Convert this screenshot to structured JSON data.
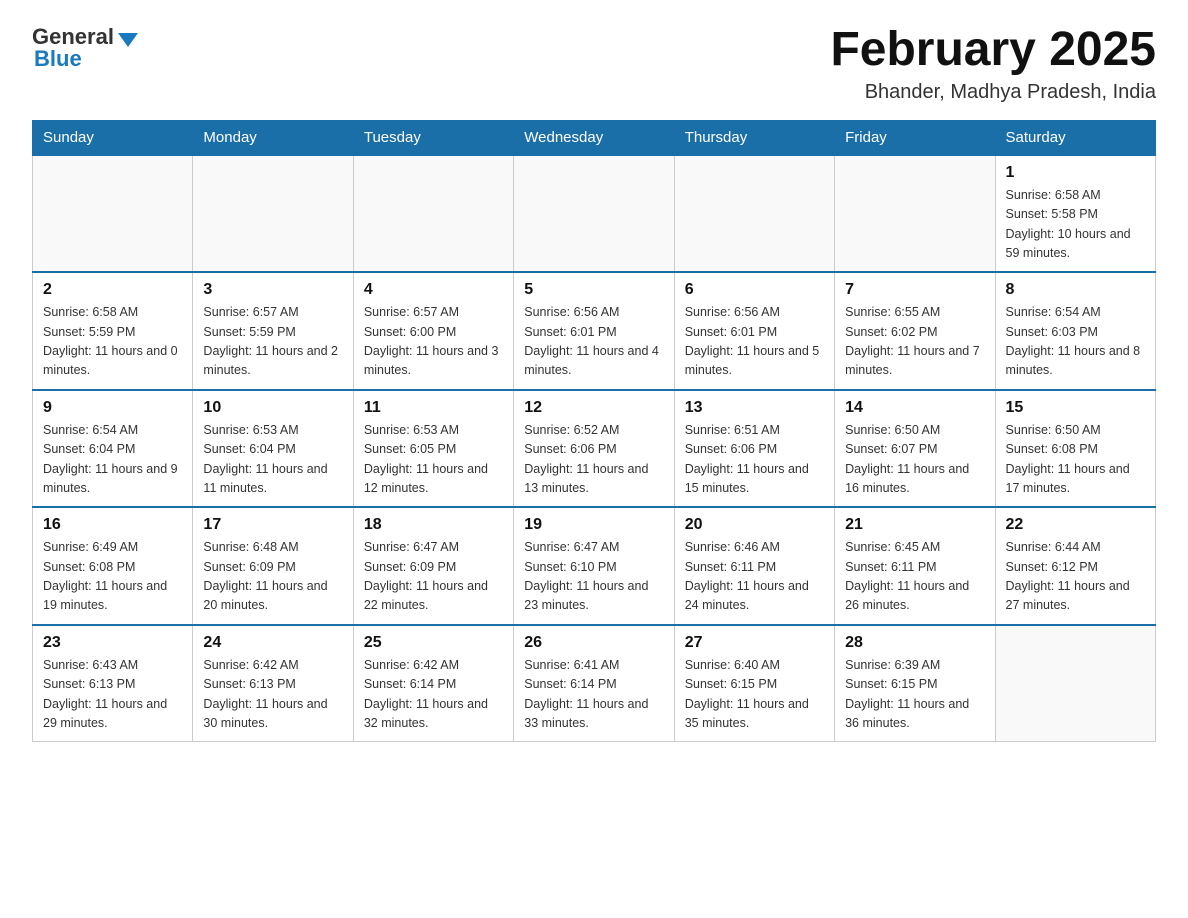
{
  "header": {
    "logo_general": "General",
    "logo_blue": "Blue",
    "month_title": "February 2025",
    "location": "Bhander, Madhya Pradesh, India"
  },
  "weekdays": [
    "Sunday",
    "Monday",
    "Tuesday",
    "Wednesday",
    "Thursday",
    "Friday",
    "Saturday"
  ],
  "weeks": [
    [
      {
        "day": "",
        "info": ""
      },
      {
        "day": "",
        "info": ""
      },
      {
        "day": "",
        "info": ""
      },
      {
        "day": "",
        "info": ""
      },
      {
        "day": "",
        "info": ""
      },
      {
        "day": "",
        "info": ""
      },
      {
        "day": "1",
        "info": "Sunrise: 6:58 AM\nSunset: 5:58 PM\nDaylight: 10 hours and 59 minutes."
      }
    ],
    [
      {
        "day": "2",
        "info": "Sunrise: 6:58 AM\nSunset: 5:59 PM\nDaylight: 11 hours and 0 minutes."
      },
      {
        "day": "3",
        "info": "Sunrise: 6:57 AM\nSunset: 5:59 PM\nDaylight: 11 hours and 2 minutes."
      },
      {
        "day": "4",
        "info": "Sunrise: 6:57 AM\nSunset: 6:00 PM\nDaylight: 11 hours and 3 minutes."
      },
      {
        "day": "5",
        "info": "Sunrise: 6:56 AM\nSunset: 6:01 PM\nDaylight: 11 hours and 4 minutes."
      },
      {
        "day": "6",
        "info": "Sunrise: 6:56 AM\nSunset: 6:01 PM\nDaylight: 11 hours and 5 minutes."
      },
      {
        "day": "7",
        "info": "Sunrise: 6:55 AM\nSunset: 6:02 PM\nDaylight: 11 hours and 7 minutes."
      },
      {
        "day": "8",
        "info": "Sunrise: 6:54 AM\nSunset: 6:03 PM\nDaylight: 11 hours and 8 minutes."
      }
    ],
    [
      {
        "day": "9",
        "info": "Sunrise: 6:54 AM\nSunset: 6:04 PM\nDaylight: 11 hours and 9 minutes."
      },
      {
        "day": "10",
        "info": "Sunrise: 6:53 AM\nSunset: 6:04 PM\nDaylight: 11 hours and 11 minutes."
      },
      {
        "day": "11",
        "info": "Sunrise: 6:53 AM\nSunset: 6:05 PM\nDaylight: 11 hours and 12 minutes."
      },
      {
        "day": "12",
        "info": "Sunrise: 6:52 AM\nSunset: 6:06 PM\nDaylight: 11 hours and 13 minutes."
      },
      {
        "day": "13",
        "info": "Sunrise: 6:51 AM\nSunset: 6:06 PM\nDaylight: 11 hours and 15 minutes."
      },
      {
        "day": "14",
        "info": "Sunrise: 6:50 AM\nSunset: 6:07 PM\nDaylight: 11 hours and 16 minutes."
      },
      {
        "day": "15",
        "info": "Sunrise: 6:50 AM\nSunset: 6:08 PM\nDaylight: 11 hours and 17 minutes."
      }
    ],
    [
      {
        "day": "16",
        "info": "Sunrise: 6:49 AM\nSunset: 6:08 PM\nDaylight: 11 hours and 19 minutes."
      },
      {
        "day": "17",
        "info": "Sunrise: 6:48 AM\nSunset: 6:09 PM\nDaylight: 11 hours and 20 minutes."
      },
      {
        "day": "18",
        "info": "Sunrise: 6:47 AM\nSunset: 6:09 PM\nDaylight: 11 hours and 22 minutes."
      },
      {
        "day": "19",
        "info": "Sunrise: 6:47 AM\nSunset: 6:10 PM\nDaylight: 11 hours and 23 minutes."
      },
      {
        "day": "20",
        "info": "Sunrise: 6:46 AM\nSunset: 6:11 PM\nDaylight: 11 hours and 24 minutes."
      },
      {
        "day": "21",
        "info": "Sunrise: 6:45 AM\nSunset: 6:11 PM\nDaylight: 11 hours and 26 minutes."
      },
      {
        "day": "22",
        "info": "Sunrise: 6:44 AM\nSunset: 6:12 PM\nDaylight: 11 hours and 27 minutes."
      }
    ],
    [
      {
        "day": "23",
        "info": "Sunrise: 6:43 AM\nSunset: 6:13 PM\nDaylight: 11 hours and 29 minutes."
      },
      {
        "day": "24",
        "info": "Sunrise: 6:42 AM\nSunset: 6:13 PM\nDaylight: 11 hours and 30 minutes."
      },
      {
        "day": "25",
        "info": "Sunrise: 6:42 AM\nSunset: 6:14 PM\nDaylight: 11 hours and 32 minutes."
      },
      {
        "day": "26",
        "info": "Sunrise: 6:41 AM\nSunset: 6:14 PM\nDaylight: 11 hours and 33 minutes."
      },
      {
        "day": "27",
        "info": "Sunrise: 6:40 AM\nSunset: 6:15 PM\nDaylight: 11 hours and 35 minutes."
      },
      {
        "day": "28",
        "info": "Sunrise: 6:39 AM\nSunset: 6:15 PM\nDaylight: 11 hours and 36 minutes."
      },
      {
        "day": "",
        "info": ""
      }
    ]
  ]
}
